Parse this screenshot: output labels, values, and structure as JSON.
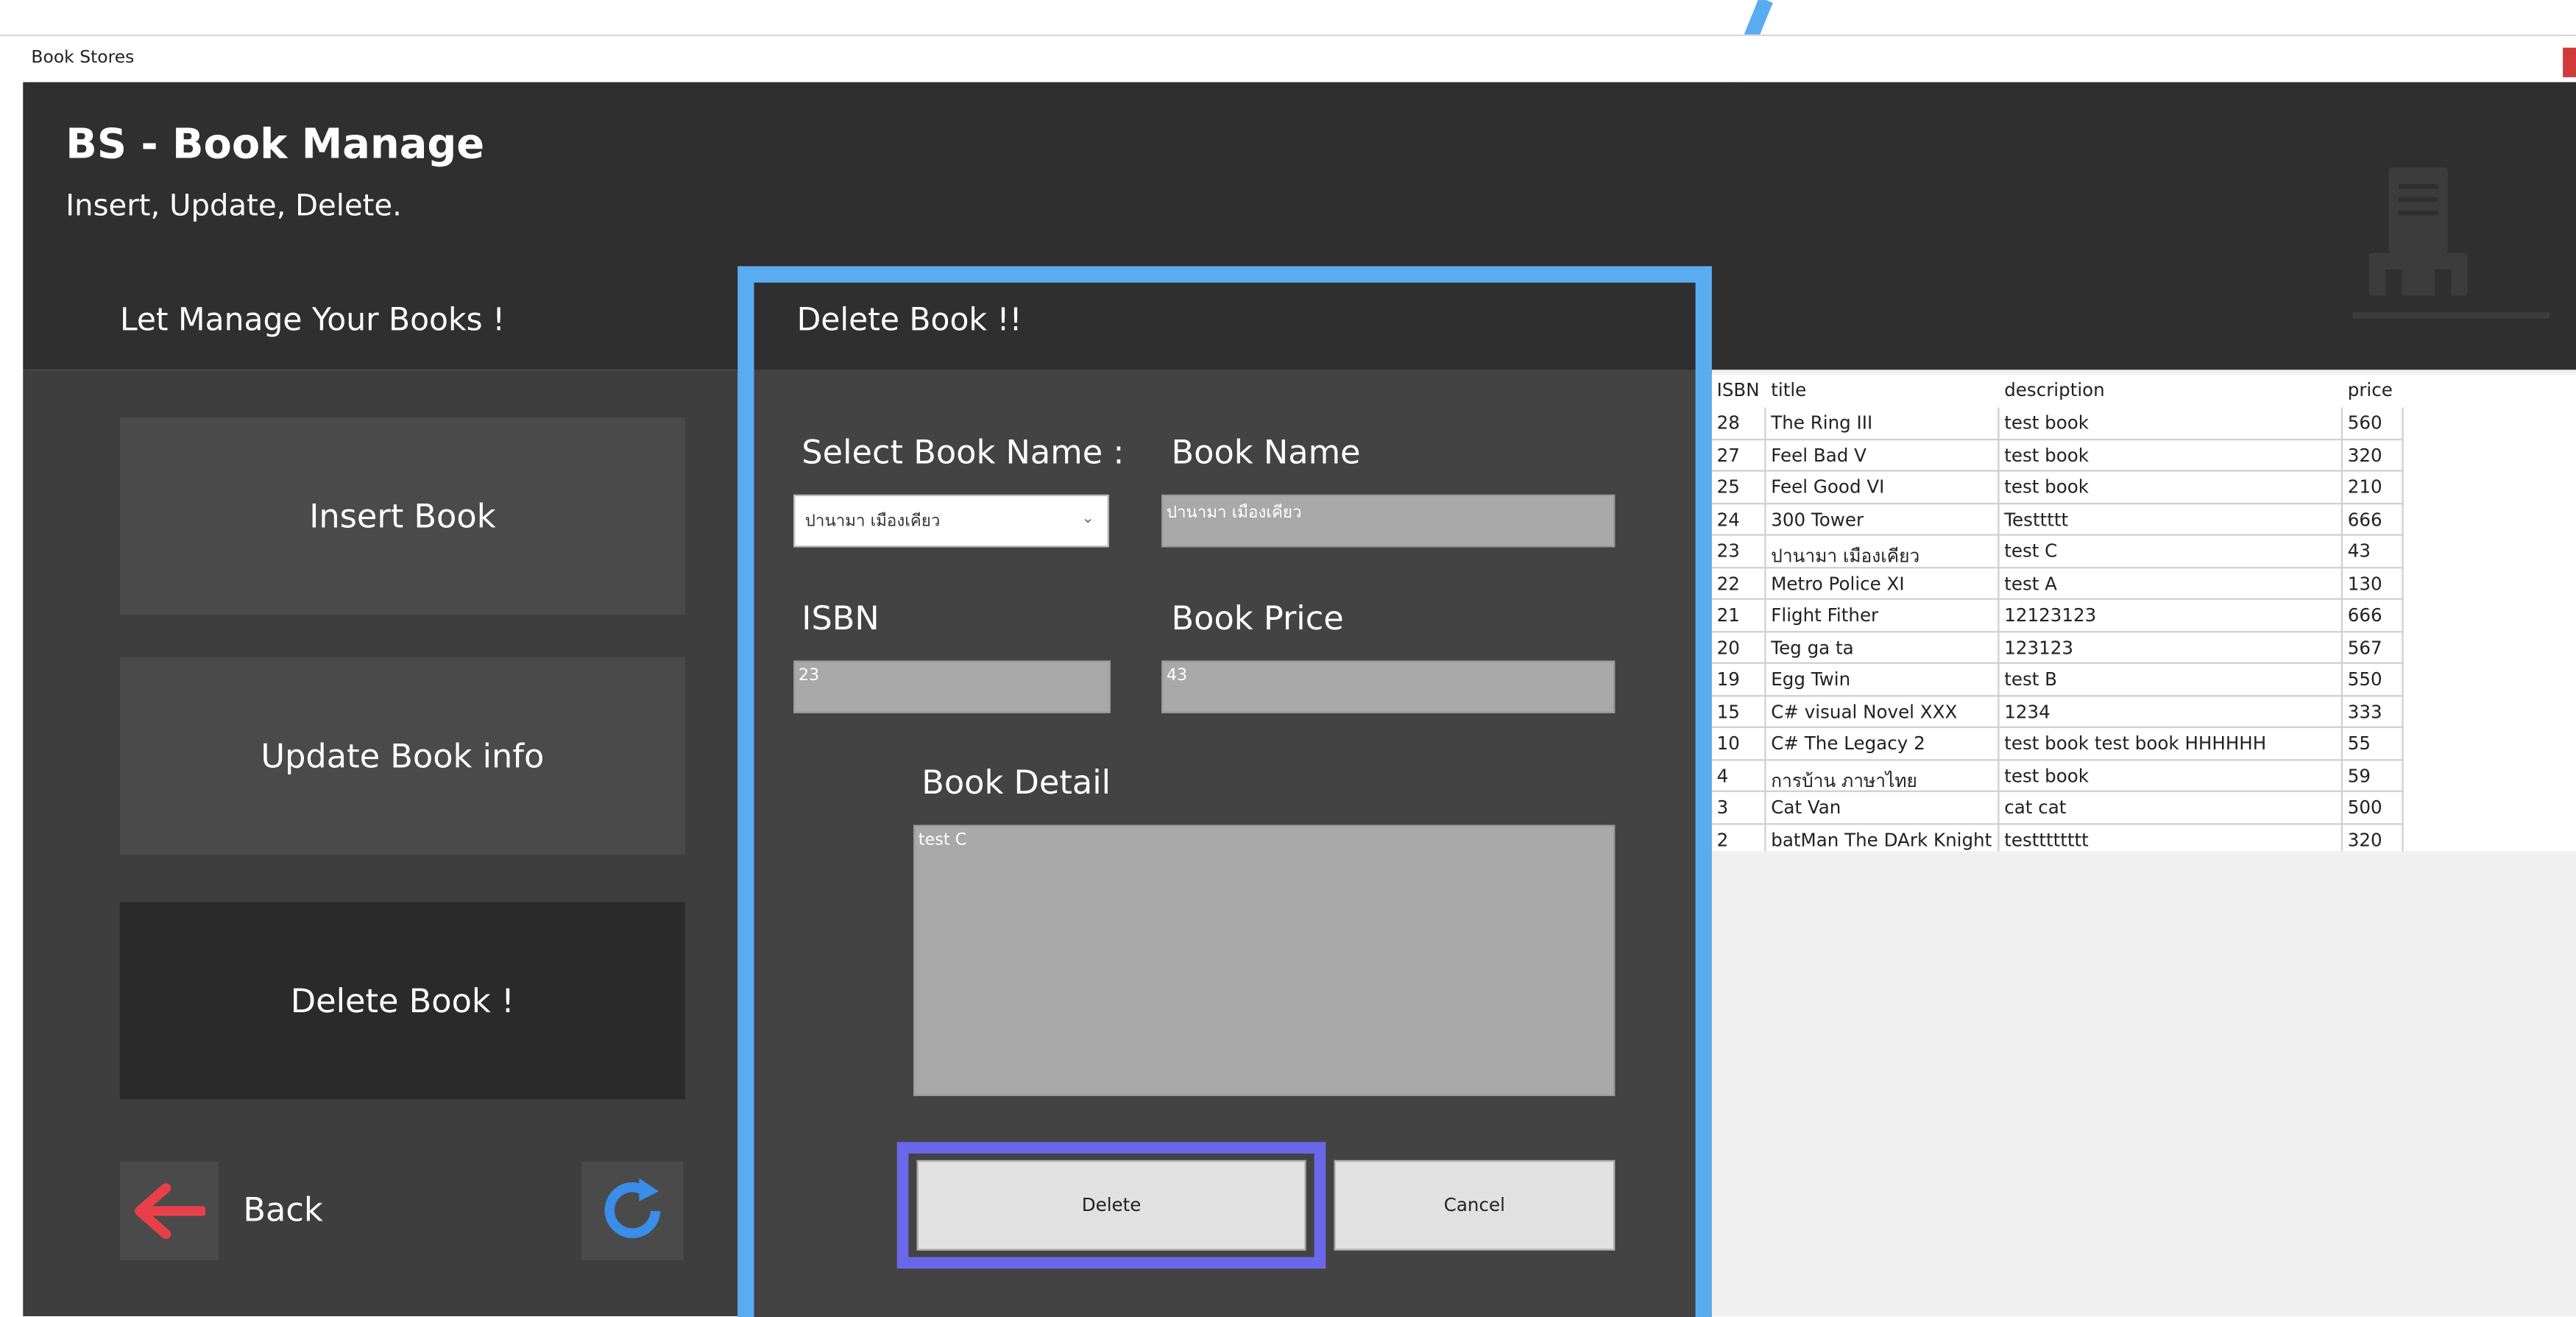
{
  "window": {
    "title": "Book Stores"
  },
  "app": {
    "title": "BS - Book Manage",
    "subtitle": "Insert, Update, Delete.",
    "section_title": "Let Manage Your Books !"
  },
  "sidebar": {
    "items": [
      {
        "label": "Insert Book"
      },
      {
        "label": "Update Book info"
      },
      {
        "label": "Delete Book !"
      }
    ],
    "back_label": "Back"
  },
  "dialog": {
    "title": "Delete Book !!",
    "select_label": "Select Book Name :",
    "select_value": "ปานามา เมืองเคียว",
    "book_name_label": "Book Name",
    "book_name_value": "ปานามา เมืองเคียว",
    "isbn_label": "ISBN",
    "isbn_value": "23",
    "price_label": "Book Price",
    "price_value": "43",
    "detail_label": "Book Detail",
    "detail_value": "test C",
    "delete_label": "Delete",
    "cancel_label": "Cancel"
  },
  "table": {
    "headers": [
      "ISBN",
      "title",
      "description",
      "price"
    ],
    "rows": [
      [
        "28",
        "The Ring III",
        "test book",
        "560"
      ],
      [
        "27",
        "Feel Bad V",
        "test book",
        "320"
      ],
      [
        "25",
        "Feel Good VI",
        "test book",
        "210"
      ],
      [
        "24",
        "300 Tower",
        "Testtttt",
        "666"
      ],
      [
        "23",
        "ปานามา เมืองเคียว",
        "test C",
        "43"
      ],
      [
        "22",
        "Metro Police XI",
        "test A",
        "130"
      ],
      [
        "21",
        "Flight Fither",
        "12123123",
        "666"
      ],
      [
        "20",
        "Teg ga ta",
        "123123",
        "567"
      ],
      [
        "19",
        "Egg Twin",
        "test B",
        "550"
      ],
      [
        "15",
        "C# visual Novel XXX",
        "1234",
        "333"
      ],
      [
        "10",
        "C# The Legacy 2",
        "test book test book HHHHHH",
        "55"
      ],
      [
        "4",
        "การบ้าน ภาษาไทย",
        "test book",
        "59"
      ],
      [
        "3",
        "Cat Van",
        "cat cat",
        "500"
      ],
      [
        "2",
        "batMan The DArk Knight",
        "testttttttt",
        "320"
      ]
    ]
  },
  "colors": {
    "header_bg": "#2f2f2f",
    "panel_bg": "#3e3e3e",
    "dialog_border": "#5aacf0",
    "focus_ring": "#6a68ea",
    "back_arrow": "#e8404a",
    "refresh_icon": "#3a8de8"
  },
  "icons": {
    "back": "arrow-left-icon",
    "refresh": "refresh-icon",
    "logo": "bookstore-logo-icon"
  }
}
